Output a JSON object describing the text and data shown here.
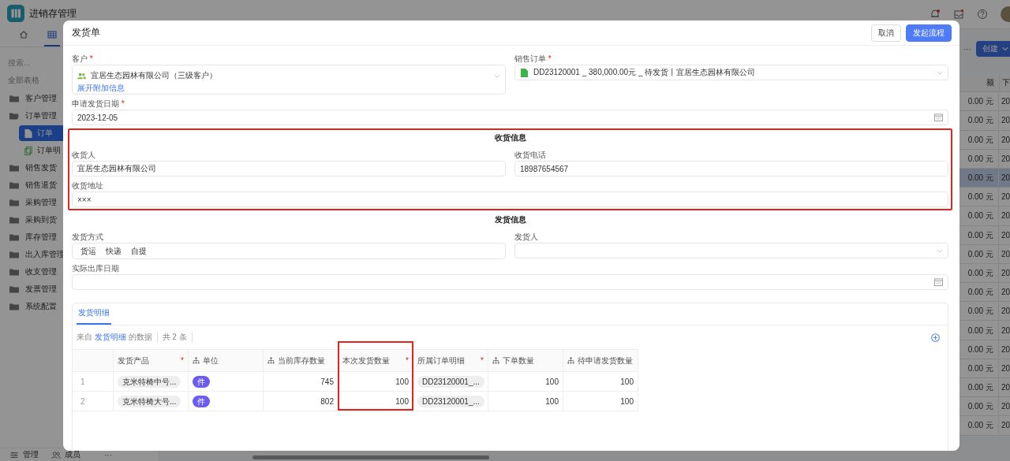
{
  "app": {
    "title": "进销存管理",
    "nav": [
      {
        "kind": "home",
        "selected": false
      },
      {
        "kind": "table",
        "selected": true
      }
    ]
  },
  "sidebar": {
    "search_placeholder": "搜索...",
    "heading": "全部表格",
    "items": [
      {
        "label": "客户管理",
        "kind": "folder",
        "expanded": false,
        "selected": false
      },
      {
        "label": "订单管理",
        "kind": "folder",
        "expanded": true,
        "selected": false,
        "children": [
          {
            "label": "订单",
            "kind": "form",
            "selected": true
          },
          {
            "label": "订单明",
            "kind": "detail",
            "selected": false
          }
        ]
      },
      {
        "label": "销售发货",
        "kind": "folder",
        "expanded": false,
        "selected": false
      },
      {
        "label": "销售退货",
        "kind": "folder",
        "expanded": false,
        "selected": false
      },
      {
        "label": "采购管理",
        "kind": "folder",
        "expanded": false,
        "selected": false
      },
      {
        "label": "采购到货",
        "kind": "folder",
        "expanded": false,
        "selected": false
      },
      {
        "label": "库存管理",
        "kind": "folder",
        "expanded": false,
        "selected": false
      },
      {
        "label": "出入库管理",
        "kind": "folder",
        "expanded": false,
        "selected": false
      },
      {
        "label": "收支管理",
        "kind": "folder",
        "expanded": false,
        "selected": false
      },
      {
        "label": "发票管理",
        "kind": "folder",
        "expanded": false,
        "selected": false
      },
      {
        "label": "系统配置",
        "kind": "folder",
        "expanded": false,
        "selected": false
      }
    ],
    "footer": [
      {
        "label": "管理",
        "kind": "settings"
      },
      {
        "label": "成员",
        "kind": "members"
      }
    ],
    "footer_more": "···"
  },
  "background_table": {
    "more": "···",
    "create_button": "创建",
    "headers": [
      "额",
      "下"
    ],
    "rows": [
      {
        "amount": "0.00 元",
        "date": "20",
        "selected": false
      },
      {
        "amount": "0.00 元",
        "date": "20",
        "selected": false
      },
      {
        "amount": "0.00 元",
        "date": "20",
        "selected": false
      },
      {
        "amount": "0.00 元",
        "date": "20",
        "selected": false
      },
      {
        "amount": "0.00 元",
        "date": "20",
        "selected": true
      },
      {
        "amount": "0.00 元",
        "date": "20",
        "selected": false
      },
      {
        "amount": "0.00 元",
        "date": "20",
        "selected": false
      },
      {
        "amount": "0.00 元",
        "date": "20",
        "selected": false
      },
      {
        "amount": "0.00 元",
        "date": "20",
        "selected": false
      },
      {
        "amount": "0.00 元",
        "date": "20",
        "selected": false
      },
      {
        "amount": "0.00 元",
        "date": "20",
        "selected": false
      },
      {
        "amount": "0.00 元",
        "date": "20",
        "selected": false
      },
      {
        "amount": "0.00 元",
        "date": "20",
        "selected": false
      },
      {
        "amount": "0.00 元",
        "date": "20",
        "selected": false
      },
      {
        "amount": "0.00 元",
        "date": "20",
        "selected": false
      },
      {
        "amount": "0.00 元",
        "date": "20",
        "selected": false
      },
      {
        "amount": "0.00 元",
        "date": "20",
        "selected": false
      },
      {
        "amount": "0.00 元",
        "date": "20",
        "selected": false
      }
    ]
  },
  "dialog": {
    "title": "发货单",
    "required_mark": "*",
    "buttons": [
      {
        "label": "取消",
        "kind": "secondary"
      },
      {
        "label": "发起流程",
        "kind": "primary"
      }
    ],
    "sections": [
      {
        "highlighted": false,
        "rows": [
          [
            {
              "kind": "contact",
              "label": "客户",
              "required": true,
              "value": "宜居生态园林有限公司（三级客户）",
              "link": "展开附加信息"
            },
            {
              "kind": "record",
              "label": "销售订单",
              "required": true,
              "value": "DD23120001 _ 380,000.00元 _ 待发货丨宜居生态园林有限公司"
            }
          ],
          [
            {
              "kind": "date",
              "label": "申请发货日期",
              "required": true,
              "value": "2023-12-05"
            }
          ]
        ]
      },
      {
        "title": "收货信息",
        "highlighted": true,
        "rows": [
          [
            {
              "kind": "text",
              "label": "收货人",
              "required": false,
              "value": "宜居生态园林有限公司"
            },
            {
              "kind": "text",
              "label": "收货电话",
              "required": false,
              "value": "18987654567"
            }
          ],
          [
            {
              "kind": "text",
              "label": "收货地址",
              "required": false,
              "value": "×××"
            }
          ]
        ]
      },
      {
        "title": "发货信息",
        "highlighted": false,
        "rows": [
          [
            {
              "kind": "options",
              "label": "发货方式",
              "required": false,
              "options": [
                {
                  "label": "货运",
                  "selected": false
                },
                {
                  "label": "快递",
                  "selected": false
                },
                {
                  "label": "自提",
                  "selected": false
                }
              ]
            },
            {
              "kind": "select",
              "label": "发货人",
              "required": false
            }
          ],
          [
            {
              "kind": "date",
              "label": "实际出库日期",
              "required": false
            }
          ]
        ]
      }
    ],
    "detail": {
      "tabs": [
        {
          "label": "发货明细",
          "selected": true
        }
      ],
      "source_prefix": "来自",
      "source_link": "发货明细",
      "source_suffix": "的数据",
      "count": "共 2 条",
      "columns": [
        {
          "label": "发货产品",
          "kind": "tag",
          "required": true,
          "lookup": false,
          "highlighted": false
        },
        {
          "label": "单位",
          "kind": "badge",
          "required": false,
          "lookup": true,
          "highlighted": false
        },
        {
          "label": "当前库存数量",
          "kind": "number",
          "required": false,
          "lookup": true,
          "highlighted": false
        },
        {
          "label": "本次发货数量",
          "kind": "number",
          "required": true,
          "lookup": false,
          "highlighted": true
        },
        {
          "label": "所属订单明细",
          "kind": "tag",
          "required": true,
          "lookup": false,
          "highlighted": false
        },
        {
          "label": "下单数量",
          "kind": "number",
          "required": false,
          "lookup": true,
          "highlighted": false
        },
        {
          "label": "待申请发货数量",
          "kind": "number",
          "required": false,
          "lookup": true,
          "highlighted": false
        }
      ],
      "rows": [
        {
          "index": "1",
          "cells": [
            "克米特椅中号...",
            "件",
            "745",
            "100",
            "DD23120001_...",
            "100",
            "100"
          ]
        },
        {
          "index": "2",
          "cells": [
            "克米特椅大号...",
            "件",
            "802",
            "100",
            "DD23120001_...",
            "100",
            "100"
          ]
        }
      ]
    }
  }
}
